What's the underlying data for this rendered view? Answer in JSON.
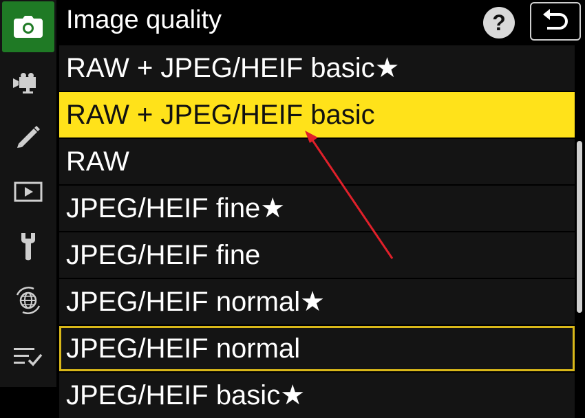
{
  "header": {
    "title": "Image quality",
    "help_label": "?"
  },
  "sidebar": {
    "items": [
      {
        "icon": "camera-icon",
        "active": true
      },
      {
        "icon": "video-camera-icon",
        "active": false
      },
      {
        "icon": "pencil-icon",
        "active": false
      },
      {
        "icon": "playback-icon",
        "active": false
      },
      {
        "icon": "wrench-icon",
        "active": false
      },
      {
        "icon": "network-globe-icon",
        "active": false
      },
      {
        "icon": "my-menu-icon",
        "active": false
      }
    ]
  },
  "menu": {
    "items": [
      {
        "label": "RAW + JPEG/HEIF basic★"
      },
      {
        "label": "RAW + JPEG/HEIF basic",
        "state": "highlighted"
      },
      {
        "label": "RAW"
      },
      {
        "label": "JPEG/HEIF fine★"
      },
      {
        "label": "JPEG/HEIF fine"
      },
      {
        "label": "JPEG/HEIF normal★"
      },
      {
        "label": "JPEG/HEIF normal",
        "state": "current"
      },
      {
        "label": "JPEG/HEIF basic★"
      }
    ]
  },
  "colors": {
    "highlight": "#ffe21a",
    "active_tab": "#1f7a25",
    "annotation_arrow": "#e0202a"
  }
}
